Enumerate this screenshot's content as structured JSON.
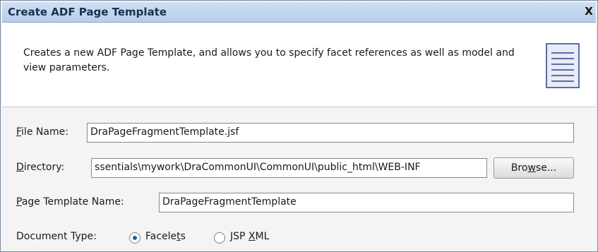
{
  "window": {
    "title": "Create ADF Page Template",
    "close_glyph": "X"
  },
  "header": {
    "description": "Creates a new ADF Page Template, and allows you to specify facet references as well as model and view parameters.",
    "icon": "document-page-icon"
  },
  "form": {
    "file_name": {
      "label_mnemonic": "F",
      "label_rest": "ile Name:",
      "value": "DraPageFragmentTemplate.jsf"
    },
    "directory": {
      "label_mnemonic": "D",
      "label_rest": "irectory:",
      "value": "ssentials\\mywork\\DraCommonUI\\CommonUI\\public_html\\WEB-INF"
    },
    "browse_button": {
      "before": "Bro",
      "mnemonic": "w",
      "after": "se..."
    },
    "page_template_name": {
      "label_mnemonic": "P",
      "label_rest": "age Template Name:",
      "value": "DraPageFragmentTemplate"
    },
    "document_type": {
      "label": "Document Type:",
      "options": [
        {
          "before": "Facele",
          "mnemonic": "t",
          "after": "s",
          "selected": true
        },
        {
          "before": "JSP ",
          "mnemonic": "X",
          "after": "ML",
          "selected": false
        }
      ]
    }
  },
  "colors": {
    "title_bar": "#b6cde9",
    "radio_selected": "#2a5ba8"
  }
}
